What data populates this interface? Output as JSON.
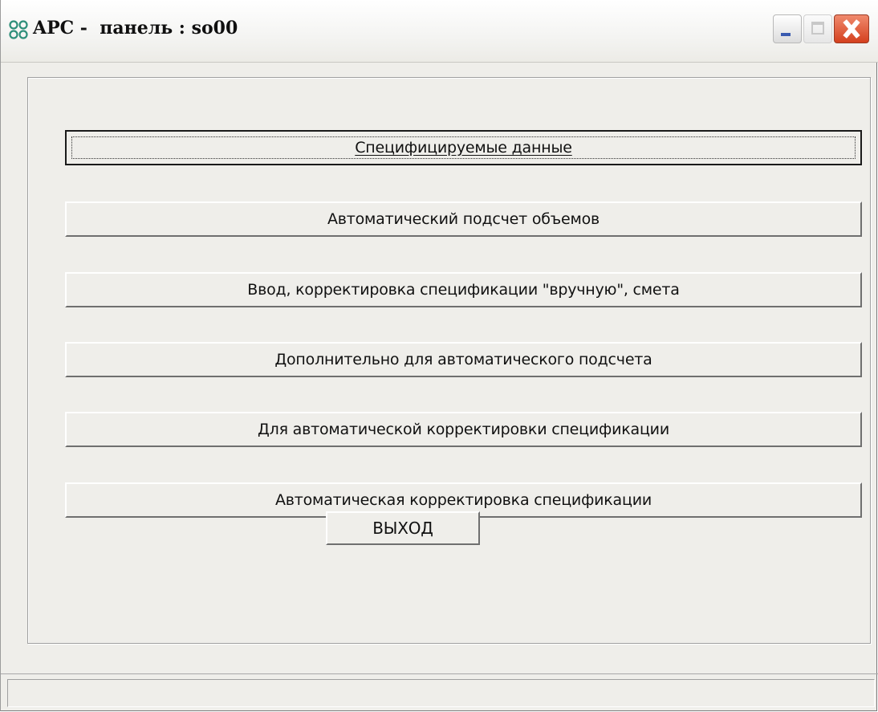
{
  "window": {
    "title": "APC -  панель : so00",
    "icon": "app-icon"
  },
  "buttons": [
    {
      "label": "Специфицируемые данные",
      "focused": true
    },
    {
      "label": "Автоматический подсчет объемов"
    },
    {
      "label": "Ввод, корректировка спецификации \"вручную\", смета"
    },
    {
      "label": "Дополнительно для автоматического подсчета"
    },
    {
      "label": "Для автоматической корректировки спецификации"
    },
    {
      "label": "Автоматическая корректировка спецификации"
    }
  ],
  "exit_button": {
    "label": "ВЫХОД"
  },
  "status": {
    "text": ""
  },
  "colors": {
    "face": "#efeeea",
    "close_button": "#d4401e",
    "icon": "#2f8f7a"
  }
}
